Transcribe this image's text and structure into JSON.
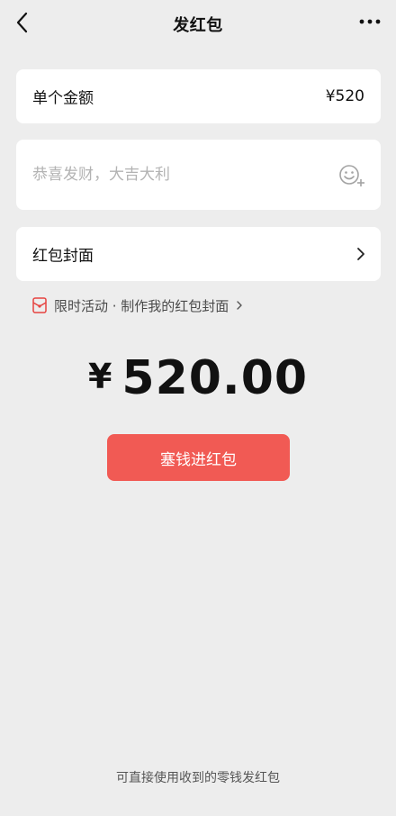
{
  "header": {
    "title": "发红包",
    "back_icon": "chevron-left-icon",
    "more_icon": "ellipsis-icon"
  },
  "amount_row": {
    "label": "单个金额",
    "value": "¥520"
  },
  "message_row": {
    "placeholder": "恭喜发财，大吉大利",
    "value": "",
    "emoji_icon": "emoji-add-icon"
  },
  "cover_row": {
    "label": "红包封面",
    "chevron_icon": "chevron-right-icon"
  },
  "promo": {
    "text": "限时活动 · 制作我的红包封面",
    "icon": "red-envelope-icon"
  },
  "total": {
    "currency": "¥",
    "amount": "520.00"
  },
  "send_button": {
    "label": "塞钱进红包"
  },
  "footer": {
    "note": "可直接使用收到的零钱发红包"
  },
  "colors": {
    "background": "#ededed",
    "card": "#ffffff",
    "button": "#f15a54",
    "promo_icon": "#e64340"
  }
}
